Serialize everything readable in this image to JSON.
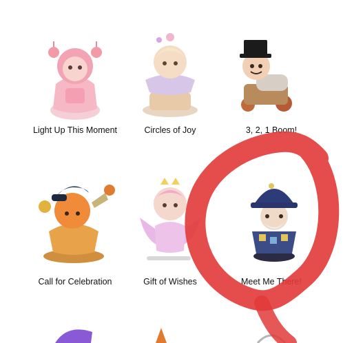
{
  "figures": [
    {
      "label": "Light Up This Moment",
      "icon": "pink-lantern-girl-figure-icon"
    },
    {
      "label": "Circles of Joy",
      "icon": "carousel-rider-figure-icon"
    },
    {
      "label": "3, 2, 1 Boom!",
      "icon": "top-hat-cannon-figure-icon"
    },
    {
      "label": "Call for Celebration",
      "icon": "trumpet-boy-figure-icon"
    },
    {
      "label": "Gift of Wishes",
      "icon": "fairy-girl-figure-icon"
    },
    {
      "label": "Meet Me There!",
      "icon": "wizard-hat-figure-icon"
    }
  ],
  "overlay": {
    "color": "#e23a3a",
    "icon": "red-circle-scribble"
  }
}
